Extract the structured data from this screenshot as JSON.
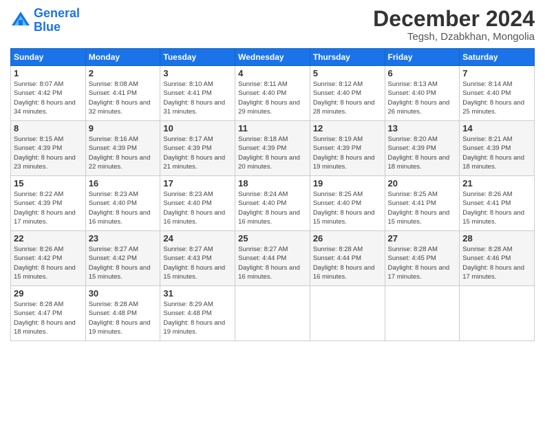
{
  "logo": {
    "line1": "General",
    "line2": "Blue"
  },
  "title": "December 2024",
  "subtitle": "Tegsh, Dzabkhan, Mongolia",
  "weekdays": [
    "Sunday",
    "Monday",
    "Tuesday",
    "Wednesday",
    "Thursday",
    "Friday",
    "Saturday"
  ],
  "days": [
    {
      "date": "1",
      "sunrise": "8:07 AM",
      "sunset": "4:42 PM",
      "daylight": "8 hours and 34 minutes."
    },
    {
      "date": "2",
      "sunrise": "8:08 AM",
      "sunset": "4:41 PM",
      "daylight": "8 hours and 32 minutes."
    },
    {
      "date": "3",
      "sunrise": "8:10 AM",
      "sunset": "4:41 PM",
      "daylight": "8 hours and 31 minutes."
    },
    {
      "date": "4",
      "sunrise": "8:11 AM",
      "sunset": "4:40 PM",
      "daylight": "8 hours and 29 minutes."
    },
    {
      "date": "5",
      "sunrise": "8:12 AM",
      "sunset": "4:40 PM",
      "daylight": "8 hours and 28 minutes."
    },
    {
      "date": "6",
      "sunrise": "8:13 AM",
      "sunset": "4:40 PM",
      "daylight": "8 hours and 26 minutes."
    },
    {
      "date": "7",
      "sunrise": "8:14 AM",
      "sunset": "4:40 PM",
      "daylight": "8 hours and 25 minutes."
    },
    {
      "date": "8",
      "sunrise": "8:15 AM",
      "sunset": "4:39 PM",
      "daylight": "8 hours and 23 minutes."
    },
    {
      "date": "9",
      "sunrise": "8:16 AM",
      "sunset": "4:39 PM",
      "daylight": "8 hours and 22 minutes."
    },
    {
      "date": "10",
      "sunrise": "8:17 AM",
      "sunset": "4:39 PM",
      "daylight": "8 hours and 21 minutes."
    },
    {
      "date": "11",
      "sunrise": "8:18 AM",
      "sunset": "4:39 PM",
      "daylight": "8 hours and 20 minutes."
    },
    {
      "date": "12",
      "sunrise": "8:19 AM",
      "sunset": "4:39 PM",
      "daylight": "8 hours and 19 minutes."
    },
    {
      "date": "13",
      "sunrise": "8:20 AM",
      "sunset": "4:39 PM",
      "daylight": "8 hours and 18 minutes."
    },
    {
      "date": "14",
      "sunrise": "8:21 AM",
      "sunset": "4:39 PM",
      "daylight": "8 hours and 18 minutes."
    },
    {
      "date": "15",
      "sunrise": "8:22 AM",
      "sunset": "4:39 PM",
      "daylight": "8 hours and 17 minutes."
    },
    {
      "date": "16",
      "sunrise": "8:23 AM",
      "sunset": "4:40 PM",
      "daylight": "8 hours and 16 minutes."
    },
    {
      "date": "17",
      "sunrise": "8:23 AM",
      "sunset": "4:40 PM",
      "daylight": "8 hours and 16 minutes."
    },
    {
      "date": "18",
      "sunrise": "8:24 AM",
      "sunset": "4:40 PM",
      "daylight": "8 hours and 16 minutes."
    },
    {
      "date": "19",
      "sunrise": "8:25 AM",
      "sunset": "4:40 PM",
      "daylight": "8 hours and 15 minutes."
    },
    {
      "date": "20",
      "sunrise": "8:25 AM",
      "sunset": "4:41 PM",
      "daylight": "8 hours and 15 minutes."
    },
    {
      "date": "21",
      "sunrise": "8:26 AM",
      "sunset": "4:41 PM",
      "daylight": "8 hours and 15 minutes."
    },
    {
      "date": "22",
      "sunrise": "8:26 AM",
      "sunset": "4:42 PM",
      "daylight": "8 hours and 15 minutes."
    },
    {
      "date": "23",
      "sunrise": "8:27 AM",
      "sunset": "4:42 PM",
      "daylight": "8 hours and 15 minutes."
    },
    {
      "date": "24",
      "sunrise": "8:27 AM",
      "sunset": "4:43 PM",
      "daylight": "8 hours and 15 minutes."
    },
    {
      "date": "25",
      "sunrise": "8:27 AM",
      "sunset": "4:44 PM",
      "daylight": "8 hours and 16 minutes."
    },
    {
      "date": "26",
      "sunrise": "8:28 AM",
      "sunset": "4:44 PM",
      "daylight": "8 hours and 16 minutes."
    },
    {
      "date": "27",
      "sunrise": "8:28 AM",
      "sunset": "4:45 PM",
      "daylight": "8 hours and 17 minutes."
    },
    {
      "date": "28",
      "sunrise": "8:28 AM",
      "sunset": "4:46 PM",
      "daylight": "8 hours and 17 minutes."
    },
    {
      "date": "29",
      "sunrise": "8:28 AM",
      "sunset": "4:47 PM",
      "daylight": "8 hours and 18 minutes."
    },
    {
      "date": "30",
      "sunrise": "8:28 AM",
      "sunset": "4:48 PM",
      "daylight": "8 hours and 19 minutes."
    },
    {
      "date": "31",
      "sunrise": "8:29 AM",
      "sunset": "4:48 PM",
      "daylight": "8 hours and 19 minutes."
    }
  ]
}
